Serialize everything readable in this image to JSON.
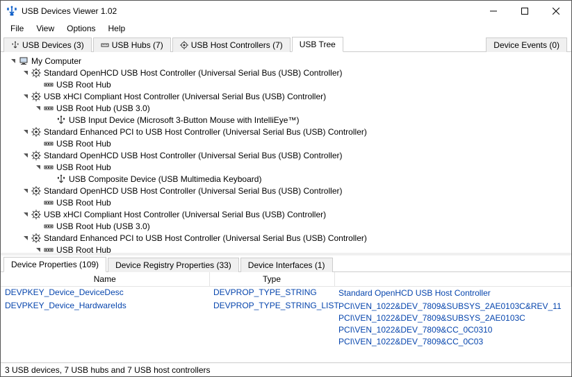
{
  "window": {
    "title": "USB Devices Viewer 1.02"
  },
  "menu": {
    "file": "File",
    "view": "View",
    "options": "Options",
    "help": "Help"
  },
  "topTabs": {
    "devices": "USB Devices (3)",
    "hubs": "USB Hubs (7)",
    "hostctrl": "USB Host Controllers (7)",
    "tree": "USB Tree",
    "events": "Device Events (0)"
  },
  "tree": [
    {
      "indent": 0,
      "toggle": "open",
      "icon": "computer",
      "text": "My Computer"
    },
    {
      "indent": 1,
      "toggle": "open",
      "icon": "gear",
      "text": "Standard OpenHCD USB Host Controller (Universal Serial Bus (USB) Controller)"
    },
    {
      "indent": 2,
      "toggle": "",
      "icon": "hub",
      "text": "USB Root Hub"
    },
    {
      "indent": 1,
      "toggle": "open",
      "icon": "gear",
      "text": "USB xHCI Compliant Host Controller (Universal Serial Bus (USB) Controller)"
    },
    {
      "indent": 2,
      "toggle": "open",
      "icon": "hub",
      "text": "USB Root Hub (USB 3.0)"
    },
    {
      "indent": 3,
      "toggle": "",
      "icon": "usb",
      "text": "USB Input Device (Microsoft 3-Button Mouse with IntelliEye™)"
    },
    {
      "indent": 1,
      "toggle": "open",
      "icon": "gear",
      "text": "Standard Enhanced PCI to USB Host Controller (Universal Serial Bus (USB) Controller)"
    },
    {
      "indent": 2,
      "toggle": "",
      "icon": "hub",
      "text": "USB Root Hub"
    },
    {
      "indent": 1,
      "toggle": "open",
      "icon": "gear",
      "text": "Standard OpenHCD USB Host Controller (Universal Serial Bus (USB) Controller)"
    },
    {
      "indent": 2,
      "toggle": "open",
      "icon": "hub",
      "text": "USB Root Hub"
    },
    {
      "indent": 3,
      "toggle": "",
      "icon": "usb",
      "text": "USB Composite Device (USB Multimedia Keyboard)"
    },
    {
      "indent": 1,
      "toggle": "open",
      "icon": "gear",
      "text": "Standard OpenHCD USB Host Controller (Universal Serial Bus (USB) Controller)"
    },
    {
      "indent": 2,
      "toggle": "",
      "icon": "hub",
      "text": "USB Root Hub"
    },
    {
      "indent": 1,
      "toggle": "open",
      "icon": "gear",
      "text": "USB xHCI Compliant Host Controller (Universal Serial Bus (USB) Controller)"
    },
    {
      "indent": 2,
      "toggle": "",
      "icon": "hub",
      "text": "USB Root Hub (USB 3.0)"
    },
    {
      "indent": 1,
      "toggle": "open",
      "icon": "gear",
      "text": "Standard Enhanced PCI to USB Host Controller (Universal Serial Bus (USB) Controller)"
    },
    {
      "indent": 2,
      "toggle": "open",
      "icon": "hub",
      "text": "USB Root Hub"
    }
  ],
  "detailTabs": {
    "props": "Device Properties (109)",
    "reg": "Device Registry Properties (33)",
    "ifaces": "Device Interfaces (1)"
  },
  "detailHeaders": {
    "name": "Name",
    "type": "Type",
    "value": ""
  },
  "detailRows": [
    {
      "name": "DEVPKEY_Device_DeviceDesc",
      "type": "DEVPROP_TYPE_STRING",
      "values": [
        "Standard OpenHCD USB Host Controller"
      ]
    },
    {
      "name": "DEVPKEY_Device_HardwareIds",
      "type": "DEVPROP_TYPE_STRING_LIST",
      "values": [
        "PCI\\VEN_1022&DEV_7809&SUBSYS_2AE0103C&REV_11",
        "PCI\\VEN_1022&DEV_7809&SUBSYS_2AE0103C",
        "PCI\\VEN_1022&DEV_7809&CC_0C0310",
        "PCI\\VEN_1022&DEV_7809&CC_0C03"
      ]
    }
  ],
  "status": "3 USB devices, 7 USB hubs and 7 USB host controllers"
}
